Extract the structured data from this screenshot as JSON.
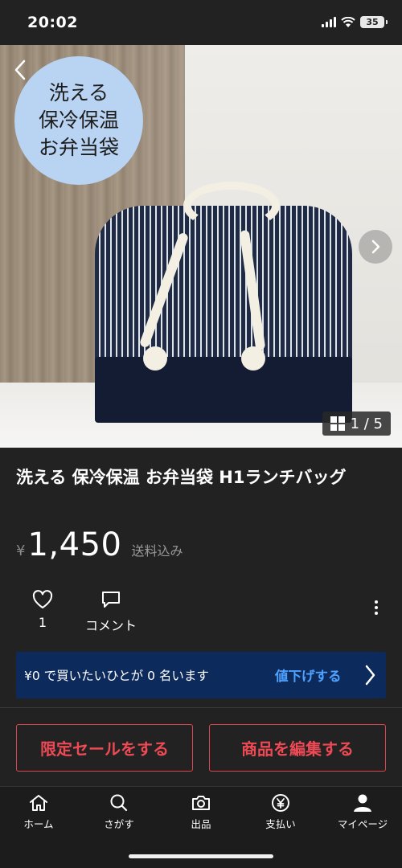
{
  "status_bar": {
    "time": "20:02",
    "battery": "35"
  },
  "hero": {
    "promo_lines": [
      "洗える",
      "保冷保温",
      "お弁当袋"
    ],
    "page_indicator": "1 / 5"
  },
  "product": {
    "title": "洗える 保冷保温 お弁当袋  H1ランチバッグ",
    "currency": "¥",
    "price": "1,450",
    "shipping": "送料込み"
  },
  "actions": {
    "like_count": "1",
    "comment_label": "コメント"
  },
  "offer": {
    "text": "¥0 で買いたいひとが 0 名います",
    "link": "値下げする"
  },
  "buttons": {
    "sale": "限定セールをする",
    "edit": "商品を編集する"
  },
  "tabs": {
    "home": "ホーム",
    "search": "さがす",
    "sell": "出品",
    "pay": "支払い",
    "mypage": "マイページ"
  },
  "colors": {
    "background": "#222222",
    "accent_red": "#ee4a55",
    "link_blue": "#4fa3ff",
    "banner_blue": "#0d2a5c",
    "promo_circle": "#b9d3f2"
  }
}
